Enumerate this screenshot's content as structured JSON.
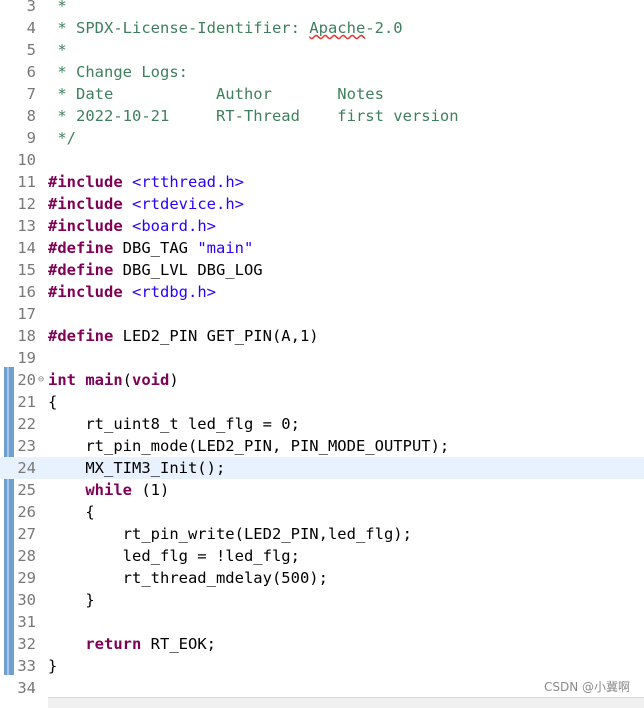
{
  "editor": {
    "lines": [
      {
        "n": "3",
        "fold": "",
        "current": false,
        "segs": [
          {
            "t": " *",
            "c": "cmt"
          }
        ]
      },
      {
        "n": "4",
        "fold": "",
        "current": false,
        "segs": [
          {
            "t": " * SPDX-License-Identifier: ",
            "c": "cmt"
          },
          {
            "t": "Apache",
            "c": "cmt spell"
          },
          {
            "t": "-2.0",
            "c": "cmt"
          }
        ]
      },
      {
        "n": "5",
        "fold": "",
        "current": false,
        "segs": [
          {
            "t": " *",
            "c": "cmt"
          }
        ]
      },
      {
        "n": "6",
        "fold": "",
        "current": false,
        "segs": [
          {
            "t": " * Change Logs:",
            "c": "cmt"
          }
        ]
      },
      {
        "n": "7",
        "fold": "",
        "current": false,
        "segs": [
          {
            "t": " * Date           Author       Notes",
            "c": "cmt"
          }
        ]
      },
      {
        "n": "8",
        "fold": "",
        "current": false,
        "segs": [
          {
            "t": " * 2022-10-21     RT-Thread    first version",
            "c": "cmt"
          }
        ]
      },
      {
        "n": "9",
        "fold": "",
        "current": false,
        "segs": [
          {
            "t": " */",
            "c": "cmt"
          }
        ]
      },
      {
        "n": "10",
        "fold": "",
        "current": false,
        "segs": []
      },
      {
        "n": "11",
        "fold": "",
        "current": false,
        "segs": [
          {
            "t": "#include",
            "c": "kw"
          },
          {
            "t": " ",
            "c": ""
          },
          {
            "t": "<rtthread.h>",
            "c": "str"
          }
        ]
      },
      {
        "n": "12",
        "fold": "",
        "current": false,
        "segs": [
          {
            "t": "#include",
            "c": "kw"
          },
          {
            "t": " ",
            "c": ""
          },
          {
            "t": "<rtdevice.h>",
            "c": "str"
          }
        ]
      },
      {
        "n": "13",
        "fold": "",
        "current": false,
        "segs": [
          {
            "t": "#include",
            "c": "kw"
          },
          {
            "t": " ",
            "c": ""
          },
          {
            "t": "<board.h>",
            "c": "str"
          }
        ]
      },
      {
        "n": "14",
        "fold": "",
        "current": false,
        "segs": [
          {
            "t": "#define",
            "c": "kw"
          },
          {
            "t": " DBG_TAG ",
            "c": ""
          },
          {
            "t": "\"main\"",
            "c": "str"
          }
        ]
      },
      {
        "n": "15",
        "fold": "",
        "current": false,
        "segs": [
          {
            "t": "#define",
            "c": "kw"
          },
          {
            "t": " DBG_LVL DBG_LOG",
            "c": ""
          }
        ]
      },
      {
        "n": "16",
        "fold": "",
        "current": false,
        "segs": [
          {
            "t": "#include",
            "c": "kw"
          },
          {
            "t": " ",
            "c": ""
          },
          {
            "t": "<rtdbg.h>",
            "c": "str"
          }
        ]
      },
      {
        "n": "17",
        "fold": "",
        "current": false,
        "segs": []
      },
      {
        "n": "18",
        "fold": "",
        "current": false,
        "segs": [
          {
            "t": "#define",
            "c": "kw"
          },
          {
            "t": " LED2_PIN GET_PIN(A,1)",
            "c": ""
          }
        ]
      },
      {
        "n": "19",
        "fold": "",
        "current": false,
        "segs": []
      },
      {
        "n": "20",
        "fold": "⊖",
        "current": false,
        "segs": [
          {
            "t": "int",
            "c": "kw"
          },
          {
            "t": " ",
            "c": ""
          },
          {
            "t": "main",
            "c": "kw"
          },
          {
            "t": "(",
            "c": ""
          },
          {
            "t": "void",
            "c": "kw"
          },
          {
            "t": ")",
            "c": ""
          }
        ]
      },
      {
        "n": "21",
        "fold": "",
        "current": false,
        "segs": [
          {
            "t": "{",
            "c": ""
          }
        ]
      },
      {
        "n": "22",
        "fold": "",
        "current": false,
        "segs": [
          {
            "t": "    rt_uint8_t led_flg = 0;",
            "c": ""
          }
        ]
      },
      {
        "n": "23",
        "fold": "",
        "current": false,
        "segs": [
          {
            "t": "    rt_pin_mode(LED2_PIN, PIN_MODE_OUTPUT);",
            "c": ""
          }
        ]
      },
      {
        "n": "24",
        "fold": "",
        "current": true,
        "segs": [
          {
            "t": "    MX_TIM3_Init();",
            "c": ""
          }
        ]
      },
      {
        "n": "25",
        "fold": "",
        "current": false,
        "segs": [
          {
            "t": "    ",
            "c": ""
          },
          {
            "t": "while",
            "c": "kw"
          },
          {
            "t": " (1)",
            "c": ""
          }
        ]
      },
      {
        "n": "26",
        "fold": "",
        "current": false,
        "segs": [
          {
            "t": "    {",
            "c": ""
          }
        ]
      },
      {
        "n": "27",
        "fold": "",
        "current": false,
        "segs": [
          {
            "t": "        rt_pin_write(LED2_PIN,led_flg);",
            "c": ""
          }
        ]
      },
      {
        "n": "28",
        "fold": "",
        "current": false,
        "segs": [
          {
            "t": "        led_flg = !led_flg;",
            "c": ""
          }
        ]
      },
      {
        "n": "29",
        "fold": "",
        "current": false,
        "segs": [
          {
            "t": "        rt_thread_mdelay(500);",
            "c": ""
          }
        ]
      },
      {
        "n": "30",
        "fold": "",
        "current": false,
        "segs": [
          {
            "t": "    }",
            "c": ""
          }
        ]
      },
      {
        "n": "31",
        "fold": "",
        "current": false,
        "segs": []
      },
      {
        "n": "32",
        "fold": "",
        "current": false,
        "segs": [
          {
            "t": "    ",
            "c": ""
          },
          {
            "t": "return",
            "c": "kw"
          },
          {
            "t": " RT_EOK;",
            "c": ""
          }
        ]
      },
      {
        "n": "33",
        "fold": "",
        "current": false,
        "segs": [
          {
            "t": "}",
            "c": ""
          }
        ]
      },
      {
        "n": "34",
        "fold": "",
        "current": false,
        "segs": []
      }
    ]
  },
  "watermark": "CSDN @小冀啊",
  "colors": {
    "keyword": "#7f0055",
    "string": "#2a00ff",
    "comment": "#3f7f5f",
    "current_line": "#e8f2fe",
    "range_bar": "#6f9fd1"
  },
  "icons": {
    "fold": "collapse-icon"
  }
}
